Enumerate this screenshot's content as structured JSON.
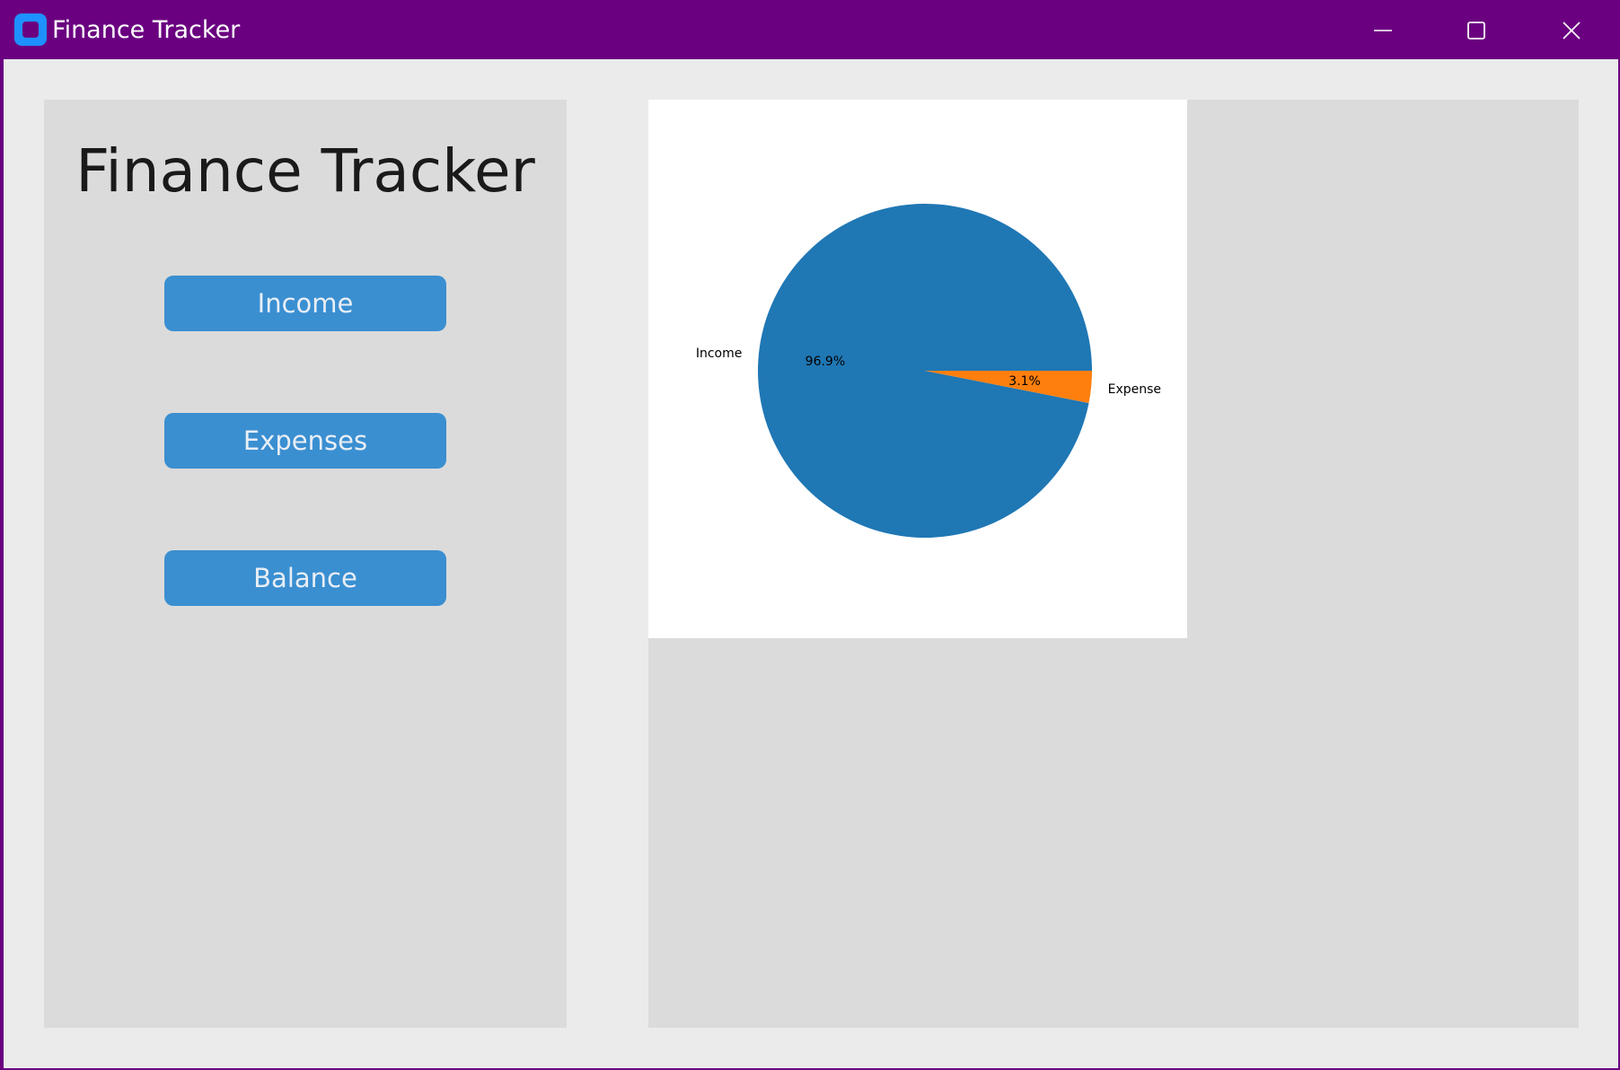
{
  "window": {
    "title": "Finance Tracker",
    "controls": {
      "minimize": "minimize-icon",
      "maximize": "maximize-icon",
      "close": "close-icon"
    },
    "accent_color": "#6a0080"
  },
  "sidebar": {
    "heading": "Finance Tracker",
    "buttons": [
      {
        "label": "Income"
      },
      {
        "label": "Expenses"
      },
      {
        "label": "Balance"
      }
    ],
    "button_color": "#3a8fd1"
  },
  "chart_data": {
    "type": "pie",
    "slices": [
      {
        "label": "Income",
        "value": 96.9,
        "pct_label": "96.9%",
        "color": "#1f77b4"
      },
      {
        "label": "Expense",
        "value": 3.1,
        "pct_label": "3.1%",
        "color": "#ff7f0e"
      }
    ],
    "start_angle_deg": 0,
    "direction": "counterclockwise"
  }
}
